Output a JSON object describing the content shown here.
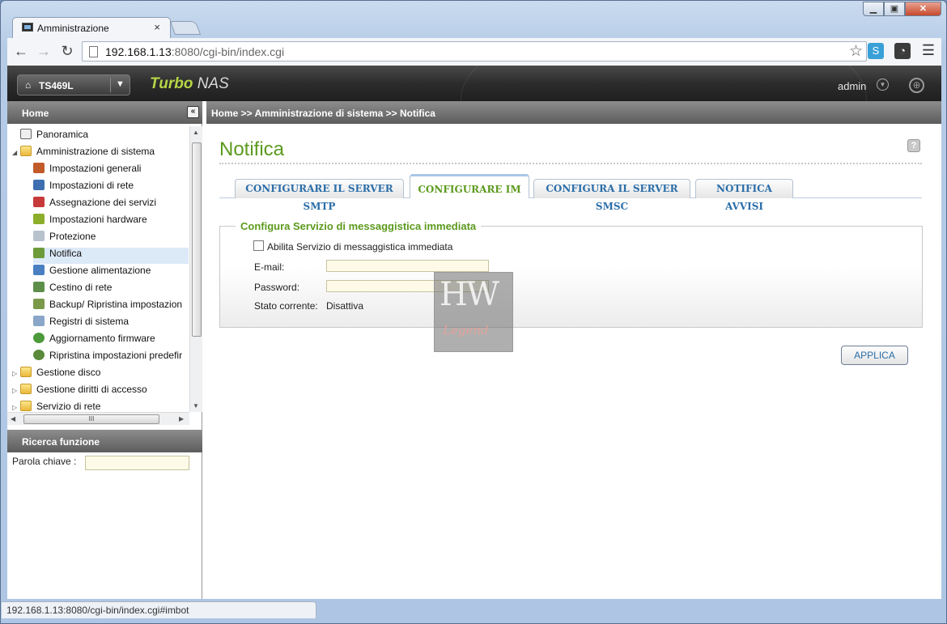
{
  "browser": {
    "tab_title": "Amministrazione",
    "tab_close": "×",
    "url_host": "192.168.1.13",
    "url_rest": ":8080/cgi-bin/index.cgi",
    "status_url": "192.168.1.13:8080/cgi-bin/index.cgi#imbot"
  },
  "app": {
    "device": "TS469L",
    "brand_turbo": "Turbo",
    "brand_nas": " NAS",
    "user": "admin"
  },
  "sidebar": {
    "header": "Home",
    "collapse_glyph": "«",
    "items": [
      {
        "label": "Panoramica",
        "icon": "overview-icon"
      },
      {
        "label": "Amministrazione di sistema",
        "icon": "folder-open-icon"
      },
      {
        "label": "Impostazioni generali",
        "icon": "settings-icon"
      },
      {
        "label": "Impostazioni di rete",
        "icon": "network-icon"
      },
      {
        "label": "Assegnazione dei servizi",
        "icon": "services-icon"
      },
      {
        "label": "Impostazioni hardware",
        "icon": "hardware-icon"
      },
      {
        "label": "Protezione",
        "icon": "security-icon"
      },
      {
        "label": "Notifica",
        "icon": "notification-icon"
      },
      {
        "label": "Gestione alimentazione",
        "icon": "power-icon"
      },
      {
        "label": "Cestino di rete",
        "icon": "recycle-bin-icon"
      },
      {
        "label": "Backup/ Ripristina impostazion",
        "icon": "backup-icon"
      },
      {
        "label": "Registri di sistema",
        "icon": "logs-icon"
      },
      {
        "label": "Aggiornamento firmware",
        "icon": "firmware-icon"
      },
      {
        "label": "Ripristina impostazioni predefir",
        "icon": "restore-icon"
      },
      {
        "label": "Gestione disco",
        "icon": "folder-icon"
      },
      {
        "label": "Gestione diritti di accesso",
        "icon": "folder-icon"
      },
      {
        "label": "Servizio di rete",
        "icon": "folder-icon"
      }
    ],
    "hscroll_grip": "III",
    "search_header": "Ricerca funzione",
    "search_label": "Parola chiave :"
  },
  "main": {
    "breadcrumb": "Home >> Amministrazione di sistema >> Notifica",
    "title": "Notifica",
    "help_glyph": "?",
    "tabs": [
      {
        "label": "CONFIGURARE IL SERVER SMTP",
        "active": false
      },
      {
        "label": "CONFIGURARE IM",
        "active": true
      },
      {
        "label": "CONFIGURA IL SERVER SMSC",
        "active": false
      },
      {
        "label": "NOTIFICA AVVISI",
        "active": false
      }
    ],
    "section_title": "Configura Servizio di messaggistica immediata",
    "enable_label": "Abilita Servizio di messaggistica immediata",
    "enable_checked": false,
    "email_label": "E-mail:",
    "email_value": "",
    "password_label": "Password:",
    "password_value": "",
    "status_label": "Stato corrente:",
    "status_value": "Disattiva",
    "apply_label": "APPLICA"
  },
  "watermark": {
    "line1": "HW",
    "line2": "Legend"
  },
  "colors": {
    "accent_green": "#5c9a1e",
    "link_blue": "#2b6ea8",
    "brand_lime": "#b6d646"
  }
}
